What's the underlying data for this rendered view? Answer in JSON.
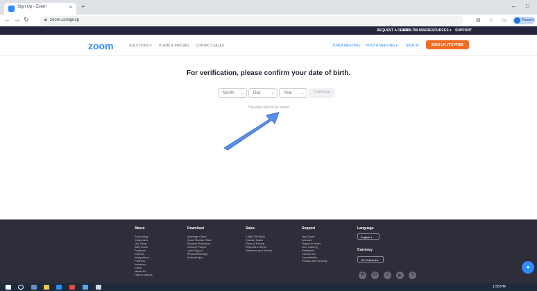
{
  "browser": {
    "tab_title": "Sign Up - Zoom",
    "tab_close": "×",
    "new_tab": "+",
    "url": "zoom.us/signup",
    "profile_label": "Paused",
    "min_glyph": "–",
    "max_glyph": "□"
  },
  "topbar": {
    "links": [
      "REQUEST A DEMO",
      "1.888.799.9666",
      "RESOURCES ▾",
      "SUPPORT"
    ]
  },
  "header": {
    "logo": "zoom",
    "nav_left": [
      "SOLUTIONS ▾",
      "PLANS & PRICING",
      "CONTACT SALES"
    ],
    "nav_right": [
      "JOIN A MEETING",
      "HOST A MEETING ▾",
      "SIGN IN"
    ],
    "signup_label": "SIGN UP, IT'S FREE"
  },
  "main": {
    "heading": "For verification, please confirm your date of birth.",
    "month": "Month",
    "day": "Day",
    "year": "Year",
    "continue_label": "Continue",
    "note": "This data will not be stored"
  },
  "footer": {
    "about": {
      "title": "About",
      "items": [
        "Zoom Blog",
        "Customers",
        "Our Team",
        "Why Zoom",
        "Features",
        "Careers",
        "Integrations",
        "Partners",
        "Investors",
        "Press",
        "Media Kit",
        "How to Videos"
      ]
    },
    "download": {
      "title": "Download",
      "items": [
        "Meetings Client",
        "Zoom Rooms Client",
        "Browser Extension",
        "Outlook Plug-in",
        "Lync Plug-in",
        "iPhone/iPad App",
        "Android App"
      ]
    },
    "sales": {
      "title": "Sales",
      "items": [
        "1.888.799.9666",
        "Contact Sales",
        "Plans & Pricing",
        "Request a Demo",
        "Webinars and Events"
      ]
    },
    "support": {
      "title": "Support",
      "items": [
        "Test Zoom",
        "Account",
        "Support Center",
        "Live Training",
        "Feedback",
        "Contact Us",
        "Accessibility",
        "Privacy and Security"
      ]
    },
    "language": {
      "title": "Language",
      "value": "English ▾"
    },
    "currency": {
      "title": "Currency",
      "value": "US Dollars $ ▾"
    },
    "social": [
      "W",
      "in",
      "t",
      "▶",
      "f"
    ]
  },
  "taskbar": {
    "clock": "1:58 PM"
  },
  "colors": {
    "zoom_blue": "#2d8cff",
    "signup_orange": "#f26d21",
    "footer_bg": "#2e2e3a",
    "topbar_bg": "#23253a"
  }
}
